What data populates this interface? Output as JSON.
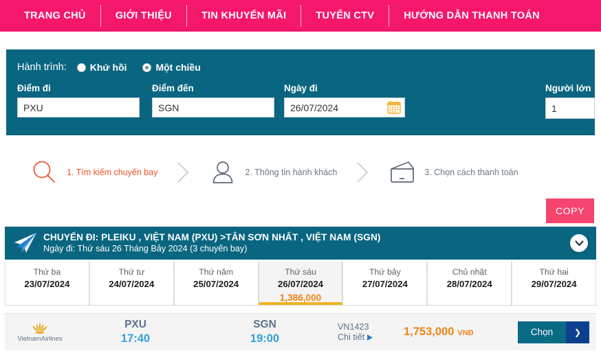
{
  "nav": {
    "items": [
      {
        "label": "TRANG CHỦ"
      },
      {
        "label": "GIỚI THIỆU"
      },
      {
        "label": "TIN KHUYẾN MÃI"
      },
      {
        "label": "TUYỂN CTV"
      },
      {
        "label": "HƯỚNG DẪN THANH TOÁN"
      }
    ]
  },
  "search": {
    "trip_label": "Hành trình:",
    "options": [
      {
        "label": "Khứ hồi",
        "checked": false
      },
      {
        "label": "Một chiều",
        "checked": true
      }
    ],
    "depart_label": "Điểm đi",
    "depart_value": "PXU",
    "arrive_label": "Điểm đến",
    "arrive_value": "SGN",
    "date_label": "Ngày đi",
    "date_value": "26/07/2024",
    "pax_label": "Người lớn",
    "pax_value": "1",
    "calendar_icon": "calendar-icon"
  },
  "steps": [
    {
      "label": "1. Tìm kiếm chuyến bay",
      "icon": "search-icon",
      "active": true
    },
    {
      "label": "2. Thông tin hành khách",
      "icon": "user-icon",
      "active": false
    },
    {
      "label": "3. Chọn cách thanh toán",
      "icon": "wallet-icon",
      "active": false
    }
  ],
  "copy_button": {
    "label": "COPY"
  },
  "flight_header": {
    "icon": "paper-plane-icon",
    "title": "CHUYẾN ĐI: PLEIKU , VIỆT NAM (PXU) >TÂN SƠN NHẤT , VIỆT NAM (SGN)",
    "subtitle": "Ngày đi: Thứ sáu 26 Tháng Bảy 2024 (3 chuyến bay)",
    "collapse_icon": "chevron-down-icon"
  },
  "date_strip": [
    {
      "day": "Thứ ba",
      "date": "23/07/2024",
      "price": "",
      "selected": false
    },
    {
      "day": "Thứ tư",
      "date": "24/07/2024",
      "price": "",
      "selected": false
    },
    {
      "day": "Thứ năm",
      "date": "25/07/2024",
      "price": "",
      "selected": false
    },
    {
      "day": "Thứ sáu",
      "date": "26/07/2024",
      "price": "1,386,000",
      "selected": true
    },
    {
      "day": "Thứ bảy",
      "date": "27/07/2024",
      "price": "",
      "selected": false
    },
    {
      "day": "Chủ nhật",
      "date": "28/07/2024",
      "price": "",
      "selected": false
    },
    {
      "day": "Thứ hai",
      "date": "29/07/2024",
      "price": "",
      "selected": false
    }
  ],
  "flight_row": {
    "airline_name": "VietnamAirlines",
    "airline_logo": "vietnam-airlines-lotus-icon",
    "depart_code": "PXU",
    "depart_time": "17:40",
    "arrive_code": "SGN",
    "arrive_time": "19:00",
    "flight_number": "VN1423",
    "detail_label": "Chi tiết",
    "detail_icon": "triangle-right-icon",
    "price": "1,753,000",
    "currency": "VNĐ",
    "choose_label": "Chọn",
    "choose_arrow_icon": "chevron-right-icon"
  },
  "colors": {
    "nav_pink": "#f5176b",
    "panel_teal": "#0a6680",
    "accent_orange": "#f08314",
    "active_step": "#e8542a",
    "copy_pink": "#f5456f",
    "time_blue": "#32a0d8",
    "selected_underline": "#f0b323"
  }
}
